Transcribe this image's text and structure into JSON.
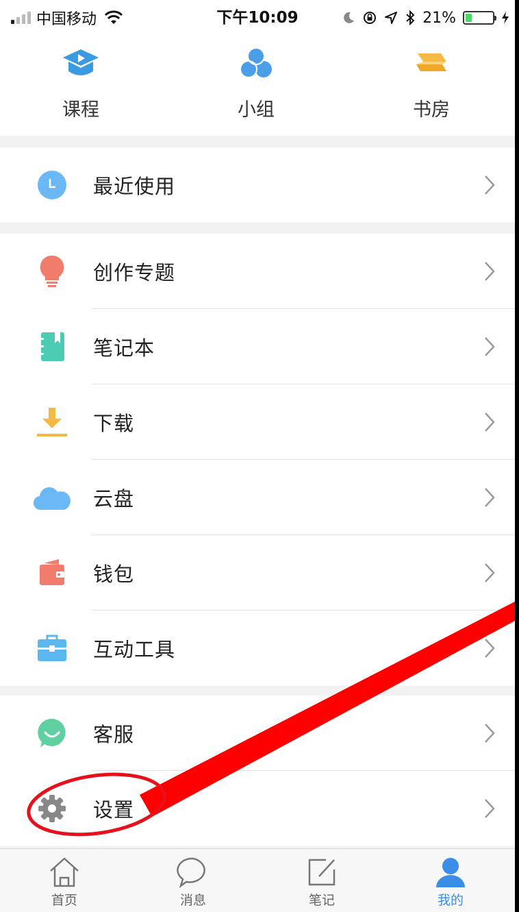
{
  "status_bar": {
    "carrier": "中国移动",
    "time": "下午10:09",
    "battery_percent": "21%",
    "battery_level": 0.21
  },
  "shortcuts": [
    {
      "label": "课程",
      "icon": "course-cap-icon",
      "color": "#3a9be0"
    },
    {
      "label": "小组",
      "icon": "group-circles-icon",
      "color": "#4a9fe8"
    },
    {
      "label": "书房",
      "icon": "study-books-icon",
      "color": "#f5b942"
    }
  ],
  "groups": {
    "recent": [
      {
        "label": "最近使用",
        "icon": "clock-icon",
        "color": "#6ab8f5"
      }
    ],
    "tools": [
      {
        "label": "创作专题",
        "icon": "lightbulb-icon",
        "color": "#f27c6c"
      },
      {
        "label": "笔记本",
        "icon": "notebook-icon",
        "color": "#4ccbb3"
      },
      {
        "label": "下载",
        "icon": "download-icon",
        "color": "#f5b942"
      },
      {
        "label": "云盘",
        "icon": "cloud-icon",
        "color": "#6ab8f5"
      },
      {
        "label": "钱包",
        "icon": "wallet-icon",
        "color": "#f27c6c"
      },
      {
        "label": "互动工具",
        "icon": "toolbox-icon",
        "color": "#5bb8ee"
      }
    ],
    "support": [
      {
        "label": "客服",
        "icon": "chat-smile-icon",
        "color": "#5fd1a0"
      },
      {
        "label": "设置",
        "icon": "gear-icon",
        "color": "#888888"
      }
    ]
  },
  "tabbar": [
    {
      "label": "首页",
      "icon": "home-icon",
      "active": false
    },
    {
      "label": "消息",
      "icon": "message-bubble-icon",
      "active": false
    },
    {
      "label": "笔记",
      "icon": "note-edit-icon",
      "active": false
    },
    {
      "label": "我的",
      "icon": "profile-icon",
      "active": true
    }
  ],
  "colors": {
    "accent": "#3a8ee6",
    "annotation": "#ff0000"
  }
}
